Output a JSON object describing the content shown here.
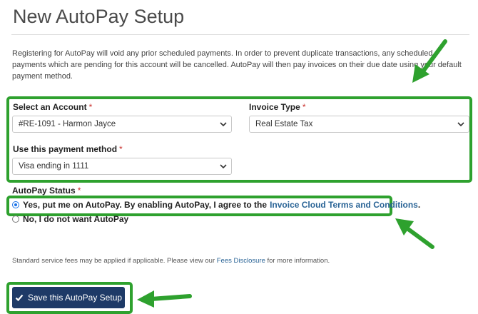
{
  "page": {
    "title": "New AutoPay Setup"
  },
  "intro": {
    "text": "Registering for AutoPay will void any prior scheduled payments. In order to prevent duplicate transactions, any scheduled payments which are pending for this account will be cancelled. AutoPay will then pay invoices on their due date using your default payment method."
  },
  "form": {
    "account": {
      "label": "Select an Account",
      "required": "*",
      "value": "#RE-1091 - Harmon Jayce"
    },
    "invoice_type": {
      "label": "Invoice Type",
      "required": "*",
      "value": "Real Estate Tax"
    },
    "payment_method": {
      "label": "Use this payment method",
      "required": "*",
      "value": "Visa ending in 1111"
    }
  },
  "autopay_status": {
    "label": "AutoPay Status",
    "required": "*",
    "yes_label": "Yes, put me on AutoPay. By enabling AutoPay, I agree to the",
    "terms_link": "Invoice Cloud Terms and Conditions",
    "terms_end": ".",
    "no_label": "No, I do not want AutoPay"
  },
  "fees": {
    "text_before": "Standard service fees may be applied if applicable. Please view our",
    "link": "Fees Disclosure",
    "text_after": "for more information."
  },
  "actions": {
    "save_label": "Save this AutoPay Setup"
  },
  "colors": {
    "highlight": "#2ea12e",
    "button": "#1e3a67",
    "link": "#2a6496",
    "required": "#c9302c"
  }
}
